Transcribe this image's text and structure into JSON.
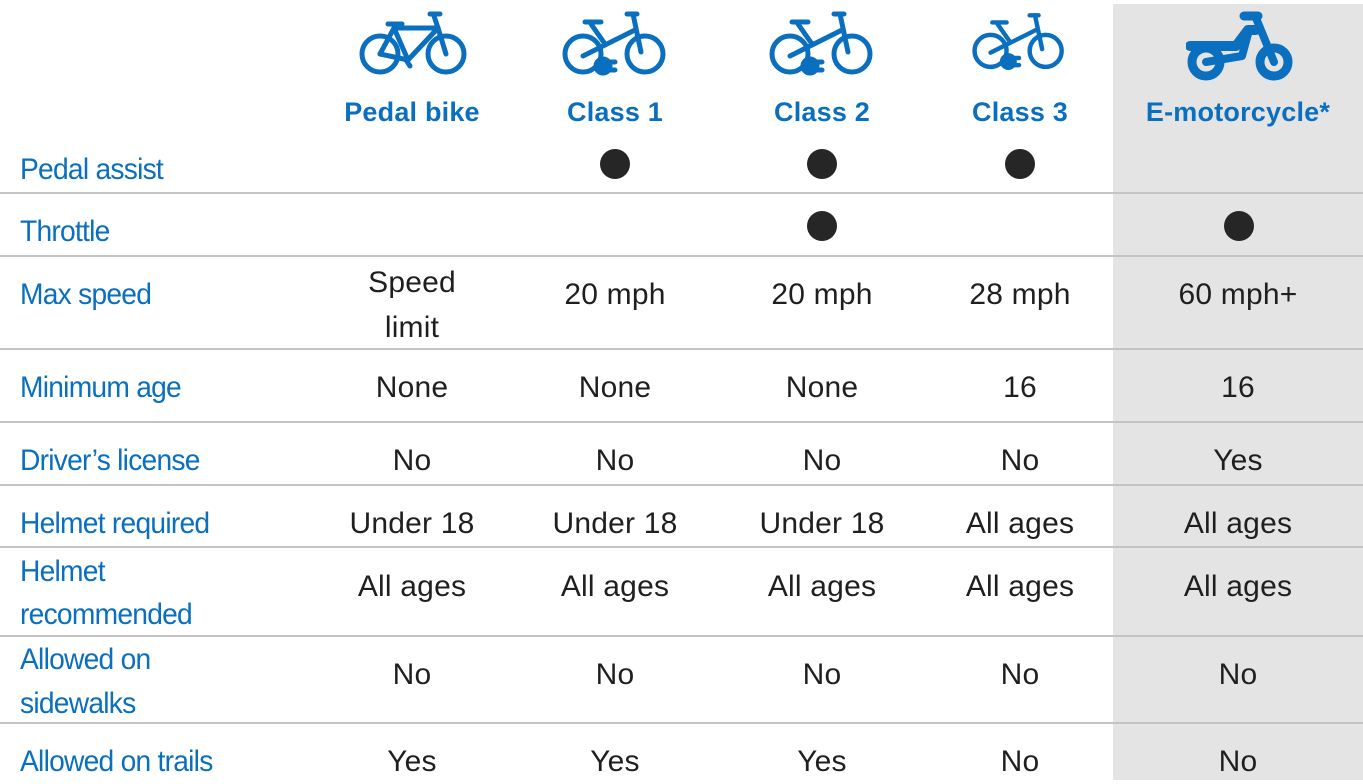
{
  "columns": [
    {
      "label": "Pedal bike",
      "icon": "pedal-bicycle-icon"
    },
    {
      "label": "Class 1",
      "icon": "electric-bicycle-icon"
    },
    {
      "label": "Class 2",
      "icon": "electric-bicycle-icon"
    },
    {
      "label": "Class 3",
      "icon": "electric-bicycle-icon"
    },
    {
      "label": "E-motorcycle*",
      "icon": "motorcycle-icon",
      "highlighted": true
    }
  ],
  "colors": {
    "accent": "#0a6fbf",
    "highlight_column_bg": "#e4e4e4",
    "divider": "#c4c4c4",
    "text": "#1f1f1f"
  },
  "rows": [
    {
      "label": "Pedal assist",
      "values": [
        "",
        "●",
        "●",
        "●",
        ""
      ]
    },
    {
      "label": "Throttle",
      "values": [
        "",
        "",
        "●",
        "",
        "●"
      ]
    },
    {
      "label": "Max speed",
      "values": [
        "Speed limit",
        "20 mph",
        "20 mph",
        "28 mph",
        "60 mph+"
      ]
    },
    {
      "label": "Minimum age",
      "values": [
        "None",
        "None",
        "None",
        "16",
        "16"
      ]
    },
    {
      "label": "Driver’s license",
      "values": [
        "No",
        "No",
        "No",
        "No",
        "Yes"
      ]
    },
    {
      "label": "Helmet required",
      "values": [
        "Under 18",
        "Under 18",
        "Under 18",
        "All ages",
        "All ages"
      ]
    },
    {
      "label": "Helmet recommended",
      "values": [
        "All ages",
        "All ages",
        "All ages",
        "All ages",
        "All ages"
      ]
    },
    {
      "label": "Allowed on sidewalks",
      "values": [
        "No",
        "No",
        "No",
        "No",
        "No"
      ]
    },
    {
      "label": "Allowed on trails",
      "values": [
        "Yes",
        "Yes",
        "Yes",
        "No",
        "No"
      ]
    }
  ],
  "text": {
    "max_speed_pedal_line1": "Speed",
    "max_speed_pedal_line2": "limit",
    "helmet_recommended_line1": "Helmet",
    "helmet_recommended_line2": "recommended",
    "sidewalks_line1": "Allowed on",
    "sidewalks_line2": "sidewalks"
  }
}
